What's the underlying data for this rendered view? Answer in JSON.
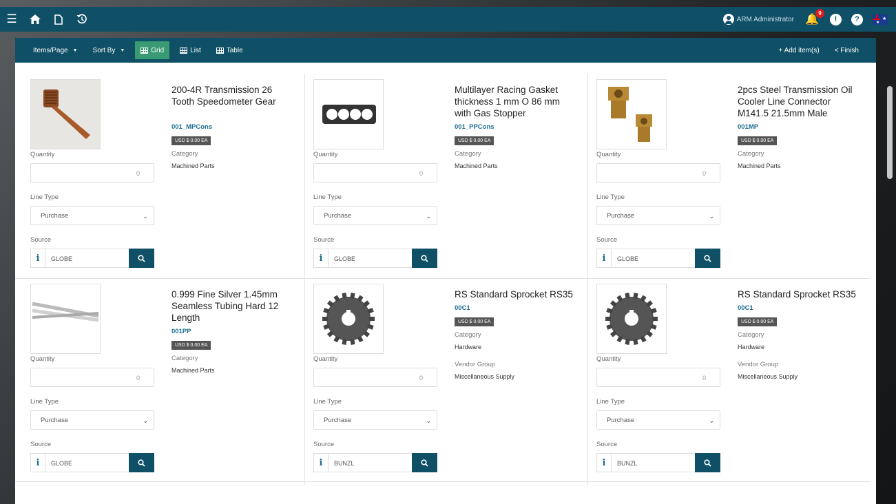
{
  "topbar": {
    "icons": [
      "menu-icon",
      "home-icon",
      "document-icon",
      "history-icon"
    ],
    "user_name": "ARM Administrator",
    "notification_count": "9"
  },
  "toolbar": {
    "items_per_page": "Items/Page",
    "sort_by": "Sort By",
    "grid": "Grid",
    "list": "List",
    "table": "Table",
    "add_items": "+ Add item(s)",
    "finish": "< Finish"
  },
  "labels": {
    "quantity": "Quantity",
    "line_type": "Line Type",
    "source": "Source",
    "category": "Category",
    "vendor_group": "Vendor Group"
  },
  "products": [
    {
      "title": "200-4R Transmission 26 Tooth Speedometer Gear",
      "code": "001_MPCons",
      "price": "USD $ 0.00 EA",
      "category": "Machined Parts",
      "vendor_group": "",
      "quantity": "0",
      "line_type": "Purchase",
      "source": "GLOBE",
      "image": "gear-shaft"
    },
    {
      "title": "Multilayer Racing Gasket thickness 1 mm O 86 mm with Gas Stopper",
      "code": "001_PPCons",
      "price": "USD $ 0.00 EA",
      "category": "Machined Parts",
      "vendor_group": "",
      "quantity": "0",
      "line_type": "Purchase",
      "source": "GLOBE",
      "image": "gasket"
    },
    {
      "title": "2pcs Steel Transmission Oil Cooler Line Connector M141.5 21.5mm Male",
      "code": "001MP",
      "price": "USD $ 0.00 EA",
      "category": "Machined Parts",
      "vendor_group": "",
      "quantity": "0",
      "line_type": "Purchase",
      "source": "GLOBE",
      "image": "connectors"
    },
    {
      "title": "0.999 Fine Silver 1.45mm Seamless Tubing Hard 12 Length",
      "code": "001PP",
      "price": "USD $ 0.00 EA",
      "category": "Machined Parts",
      "vendor_group": "",
      "quantity": "0",
      "line_type": "Purchase",
      "source": "GLOBE",
      "image": "tubing"
    },
    {
      "title": "RS Standard Sprocket RS35",
      "code": "00C1",
      "price": "USD $ 0.00 EA",
      "category": "Hardware",
      "vendor_group": "Miscellaneous Supply",
      "quantity": "0",
      "line_type": "Purchase",
      "source": "BUNZL",
      "image": "sprocket"
    },
    {
      "title": "RS Standard Sprocket RS35",
      "code": "00C1",
      "price": "USD $ 0.00 EA",
      "category": "Hardware",
      "vendor_group": "Miscellaneous Supply",
      "quantity": "0",
      "line_type": "Purchase",
      "source": "BUNZL",
      "image": "sprocket"
    }
  ]
}
